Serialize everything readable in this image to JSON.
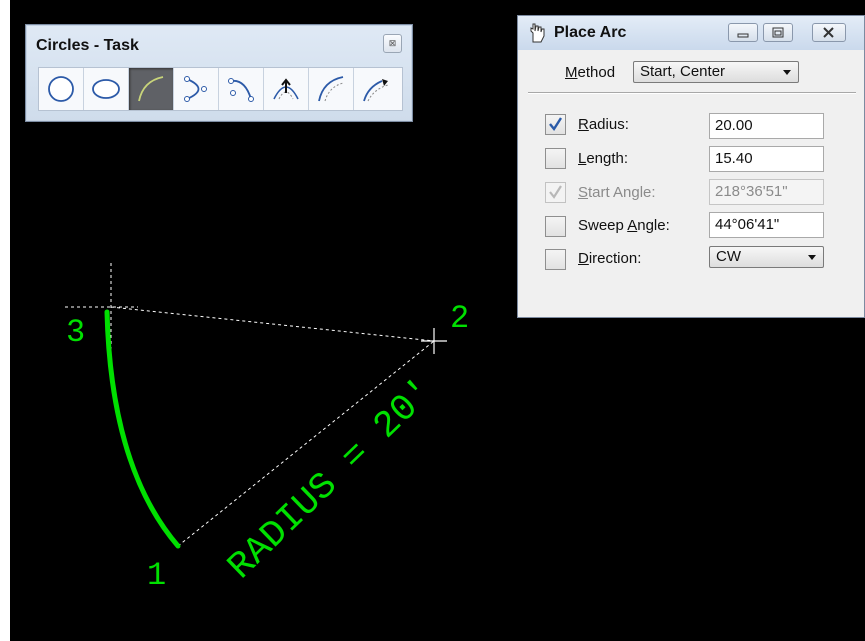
{
  "task_panel": {
    "title": "Circles - Task",
    "close_glyph": "⊠",
    "tools": [
      {
        "name": "place-circle-icon",
        "active": false
      },
      {
        "name": "place-ellipse-icon",
        "active": false
      },
      {
        "name": "place-arc-icon",
        "active": true
      },
      {
        "name": "place-half-ellipse-icon",
        "active": false
      },
      {
        "name": "place-quarter-ellipse-icon",
        "active": false
      },
      {
        "name": "modify-arc-radius-icon",
        "active": false
      },
      {
        "name": "modify-arc-angle-icon",
        "active": false
      },
      {
        "name": "modify-arc-axis-icon",
        "active": false
      }
    ]
  },
  "dialog": {
    "title": "Place Arc",
    "method_label": "Method",
    "method_value": "Start, Center",
    "fields": [
      {
        "label": "Radius:",
        "value": "20.00",
        "checked": true,
        "disabled": false
      },
      {
        "label": "Length:",
        "value": "15.40",
        "checked": false,
        "disabled": false
      },
      {
        "label": "Start Angle:",
        "value": "218°36'51\"",
        "checked": true,
        "disabled": true
      },
      {
        "label": "Sweep Angle:",
        "value": "44°06'41\"",
        "checked": false,
        "disabled": false
      },
      {
        "label": "Direction:",
        "value": "CW",
        "checked": false,
        "disabled": false
      }
    ]
  },
  "drawing": {
    "annotation": "RADIUS = 20'",
    "point_labels": [
      "1",
      "2",
      "3"
    ],
    "arc_color": "#00e000",
    "text_color": "#00e000",
    "construction_color": "#ffffff"
  }
}
